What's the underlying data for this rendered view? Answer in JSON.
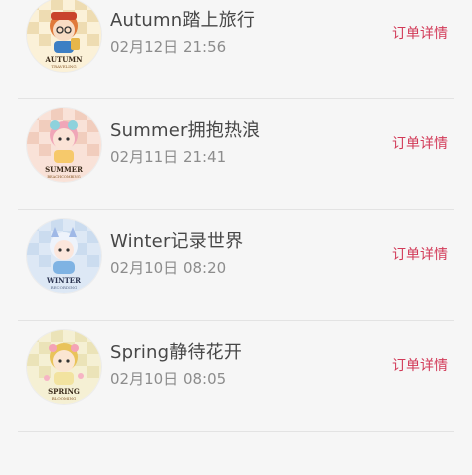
{
  "orders": [
    {
      "title": "Autumn踏上旅行",
      "time": "02月12日 21:56",
      "detail_label": "订单详情",
      "badge_text": "AUTUMN",
      "badge_sub": "TRAVELING",
      "theme": "autumn"
    },
    {
      "title": "Summer拥抱热浪",
      "time": "02月11日 21:41",
      "detail_label": "订单详情",
      "badge_text": "SUMMER",
      "badge_sub": "BEACHCOMBING",
      "theme": "summer"
    },
    {
      "title": "Winter记录世界",
      "time": "02月10日 08:20",
      "detail_label": "订单详情",
      "badge_text": "WINTER",
      "badge_sub": "RECORDING",
      "theme": "winter"
    },
    {
      "title": "Spring静待花开",
      "time": "02月10日 08:05",
      "detail_label": "订单详情",
      "badge_text": "SPRING",
      "badge_sub": "BLOOMING",
      "theme": "spring"
    }
  ],
  "colors": {
    "accent": "#d23a58",
    "title": "#474747",
    "time": "#8c8c8c",
    "divider": "#e3e3e3",
    "background": "#f6f6f6"
  }
}
